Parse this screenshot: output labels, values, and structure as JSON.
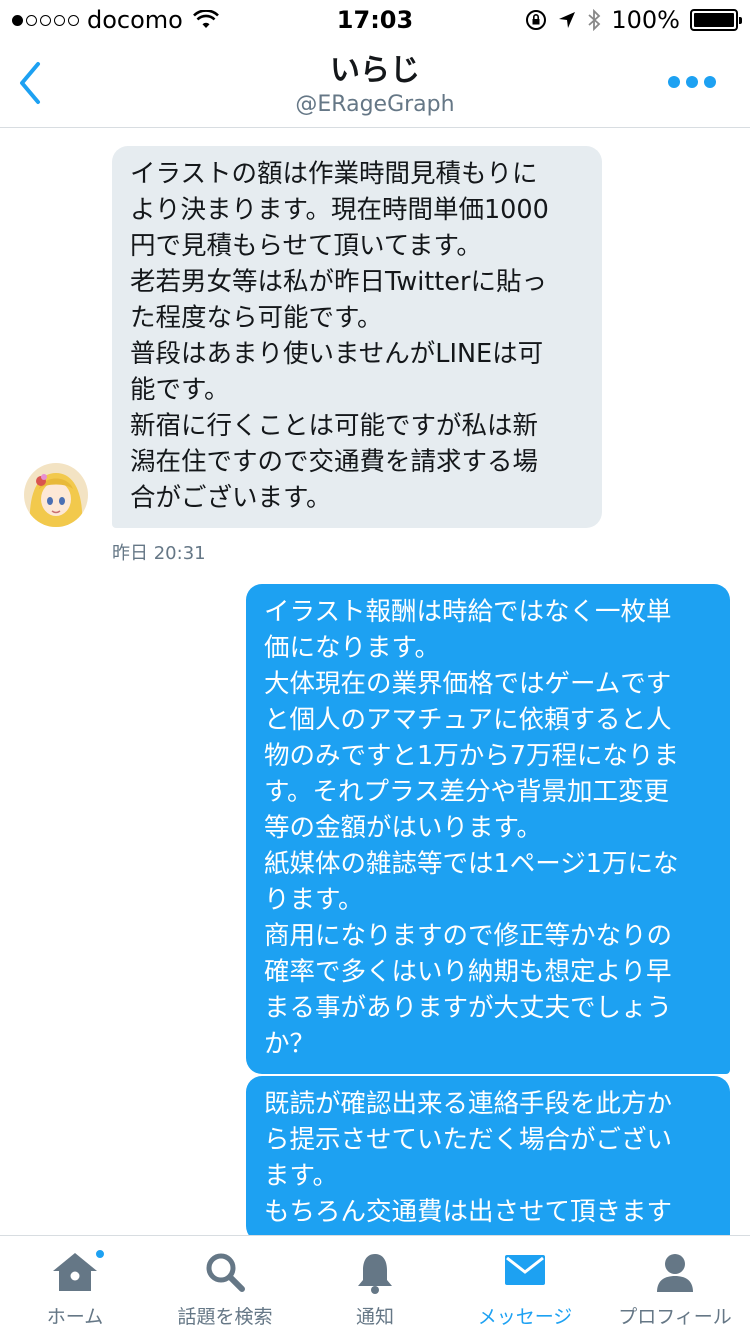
{
  "status_bar": {
    "carrier": "docomo",
    "time": "17:03",
    "battery": "100%",
    "signal_bars_filled": 1
  },
  "header": {
    "title": "いらじ",
    "handle": "@ERageGraph"
  },
  "messages": [
    {
      "direction": "incoming",
      "text": "イラストの額は作業時間見積もりに\nより決まります。現在時間単価1000\n円で見積もらせて頂いてます。\n老若男女等は私が昨日Twitterに貼っ\nた程度なら可能です。\n普段はあまり使いませんがLINEは可\n能です。\n新宿に行くことは可能ですが私は新\n潟在住ですので交通費を請求する場\n合がございます。",
      "timestamp": "昨日 20:31"
    },
    {
      "direction": "outgoing",
      "text": "イラスト報酬は時給ではなく一枚単\n価になります。\n大体現在の業界価格ではゲームです\nと個人のアマチュアに依頼すると人\n物のみですと1万から7万程になりま\nす。それプラス差分や背景加工変更\n等の金額がはいります。\n紙媒体の雑誌等では1ページ1万にな\nります。\n商用になりますので修正等かなりの\n確率で多くはいり納期も想定より早\nまる事がありますが大丈夫でしょう\nか？"
    },
    {
      "direction": "outgoing",
      "text": "既読が確認出来る連絡手段を此方か\nら提示させていただく場合がござい\nます。\nもちろん交通費は出させて頂きます"
    }
  ],
  "tabbar": {
    "items": [
      {
        "label": "ホーム",
        "icon": "home-icon",
        "has_badge": true
      },
      {
        "label": "話題を検索",
        "icon": "search-icon"
      },
      {
        "label": "通知",
        "icon": "bell-icon"
      },
      {
        "label": "メッセージ",
        "icon": "mail-icon",
        "active": true
      },
      {
        "label": "プロフィール",
        "icon": "person-icon"
      }
    ]
  },
  "colors": {
    "accent": "#1da1f2",
    "incoming_bubble": "#e6ecf0",
    "secondary_text": "#657786"
  }
}
